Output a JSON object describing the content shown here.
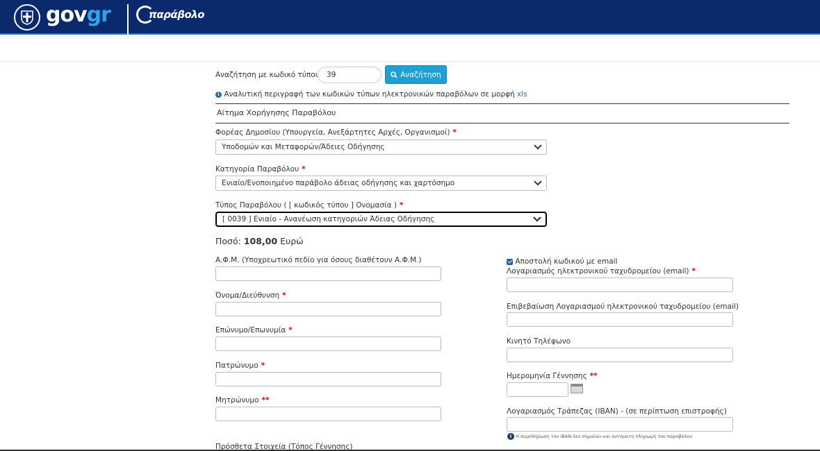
{
  "header": {
    "brand_gov": "gov",
    "brand_gr": "gr",
    "app_logo_text": "παράβολο"
  },
  "search": {
    "label": "Αναζήτηση με κωδικό τύπου",
    "value": "39",
    "button_label": "Αναζήτηση"
  },
  "info_line": {
    "text": "Αναλυτική περιγραφή των κωδικών τύπων ηλεκτρονικών παραβόλων σε μορφή",
    "link": "xls"
  },
  "section_title": "Αίτημα Χορήγησης Παραβόλου",
  "fields": {
    "agency": {
      "label": "Φορέας Δημοσίου (Υπουργεία, Ανεξάρτητες Αρχές, Οργανισμοί)",
      "required": "*",
      "value": "Υποδομών και Μεταφορών/Άδειες Οδήγησης"
    },
    "category": {
      "label": "Κατηγορία Παραβόλου",
      "required": "*",
      "value": "Ενιαίο/Ενοποιημένο παράβολο άδειας οδήγησης και χαρτόσημο"
    },
    "type": {
      "label": "Τύπος Παραβόλου ( [ κωδικός τύπου ] Ονομασία )",
      "required": "*",
      "value": "[ 0039 ] Ενιαίο - Ανανέωση κατηγοριών Άδειας Οδήγησης"
    },
    "amount": {
      "label": "Ποσό:",
      "value": "108,00",
      "currency": "Ευρώ"
    },
    "afm": {
      "label": "Α.Φ.Μ. (Υποχρεωτικό πεδίο για όσους διαθέτουν Α.Φ.Μ.)"
    },
    "name": {
      "label": "Όνομα/Διεύθυνση",
      "required": "*"
    },
    "surname": {
      "label": "Επώνυμο/Επωνυμία",
      "required": "*"
    },
    "father_name": {
      "label": "Πατρώνυμο",
      "required": "*"
    },
    "mother_name": {
      "label": "Μητρώνυμο",
      "required": "**"
    },
    "extra": {
      "label": "Πρόσθετα Στοιχεία (Τόπος Γέννησης)"
    },
    "send_code": {
      "label": "Αποστολή κωδικού με email",
      "checked": true
    },
    "email": {
      "label": "Λογαριασμός ηλεκτρονικού ταχυδρομείου (email)",
      "required": "*"
    },
    "email_confirm": {
      "label": "Επιβεβαίωση Λογαριασμού ηλεκτρονικού ταχυδρομείου (email)"
    },
    "mobile": {
      "label": "Κινητό Τηλέφωνο"
    },
    "birth_date": {
      "label": "Ημερομηνία Γέννησης",
      "required": "**"
    },
    "iban": {
      "label": "Λογαριασμός Τράπεζας (IBAN) - (σε περίπτωση επιστροφής)",
      "note": "Η συμπλήρωση του IBAN δεν σημαίνει και αυτόματη πληρωμή του παραβόλου"
    }
  },
  "colors": {
    "header_bg": "#0b2a6d",
    "accent": "#1e9fd6",
    "required": "#dd0000"
  }
}
